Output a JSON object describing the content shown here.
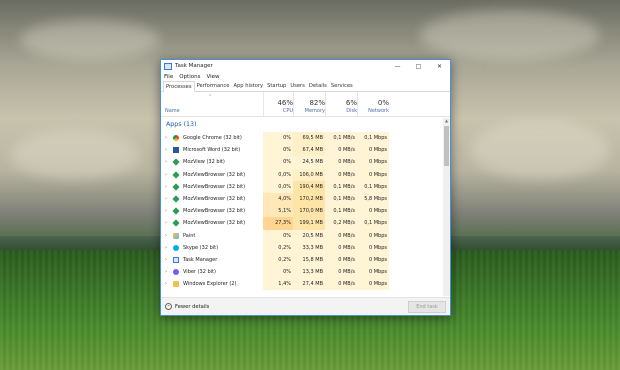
{
  "window": {
    "title": "Task Manager"
  },
  "menu": [
    "File",
    "Options",
    "View"
  ],
  "tabs": [
    "Processes",
    "Performance",
    "App history",
    "Startup",
    "Users",
    "Details",
    "Services"
  ],
  "header": {
    "name": "Name",
    "cpu": {
      "pct": "46%",
      "label": "CPU"
    },
    "memory": {
      "pct": "82%",
      "label": "Memory"
    },
    "disk": {
      "pct": "6%",
      "label": "Disk"
    },
    "network": {
      "pct": "0%",
      "label": "Network"
    }
  },
  "group": {
    "label": "Apps (13)"
  },
  "processes": [
    {
      "name": "Google Chrome (32 bit)",
      "icon": "chrome-icon",
      "cpu": "0%",
      "mem": "69,5 MB",
      "disk": "0,1 MB/s",
      "net": "0,1 Mbps"
    },
    {
      "name": "Microsoft Word (32 bit)",
      "icon": "word-icon",
      "cpu": "0%",
      "mem": "67,4 MB",
      "disk": "0 MB/s",
      "net": "0 Mbps"
    },
    {
      "name": "MozView (32 bit)",
      "icon": "mozview-icon",
      "cpu": "0%",
      "mem": "24,5 MB",
      "disk": "0 MB/s",
      "net": "0 Mbps"
    },
    {
      "name": "MozViewBrowser (32 bit)",
      "icon": "mozview-icon",
      "cpu": "0,0%",
      "mem": "106,0 MB",
      "disk": "0 MB/s",
      "net": "0 Mbps"
    },
    {
      "name": "MozViewBrowser (32 bit)",
      "icon": "mozview-icon",
      "cpu": "0,0%",
      "mem": "190,4 MB",
      "disk": "0,1 MB/s",
      "net": "0,1 Mbps"
    },
    {
      "name": "MozViewBrowser (32 bit)",
      "icon": "mozview-icon",
      "cpu": "4,0%",
      "mem": "170,2 MB",
      "disk": "0,1 MB/s",
      "net": "5,8 Mbps"
    },
    {
      "name": "MozViewBrowser (32 bit)",
      "icon": "mozview-icon",
      "cpu": "5,1%",
      "mem": "170,0 MB",
      "disk": "0,1 MB/s",
      "net": "0 Mbps"
    },
    {
      "name": "MozViewBrowser (32 bit)",
      "icon": "mozview-icon",
      "cpu": "27,3%",
      "mem": "199,1 MB",
      "disk": "0,2 MB/s",
      "net": "0,1 Mbps"
    },
    {
      "name": "Paint",
      "icon": "paint-icon",
      "cpu": "0%",
      "mem": "20,5 MB",
      "disk": "0 MB/s",
      "net": "0 Mbps"
    },
    {
      "name": "Skype (32 bit)",
      "icon": "skype-icon",
      "cpu": "0,2%",
      "mem": "33,3 MB",
      "disk": "0 MB/s",
      "net": "0 Mbps"
    },
    {
      "name": "Task Manager",
      "icon": "taskmanager-icon",
      "cpu": "0,2%",
      "mem": "15,8 MB",
      "disk": "0 MB/s",
      "net": "0 Mbps"
    },
    {
      "name": "Viber (32 bit)",
      "icon": "viber-icon",
      "cpu": "0%",
      "mem": "13,3 MB",
      "disk": "0 MB/s",
      "net": "0 Mbps"
    },
    {
      "name": "Windows Explorer (2)",
      "icon": "explorer-icon",
      "cpu": "1,4%",
      "mem": "27,4 MB",
      "disk": "0 MB/s",
      "net": "0 Mbps"
    }
  ],
  "footer": {
    "fewer_details": "Fewer details",
    "end_task": "End task"
  }
}
